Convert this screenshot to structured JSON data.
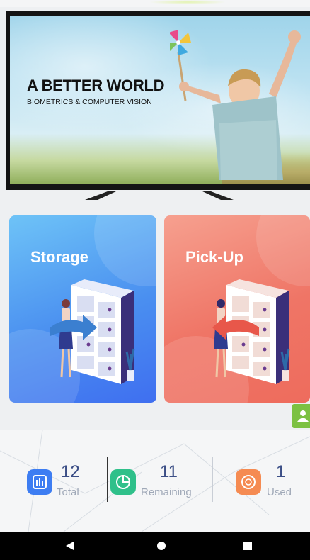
{
  "banner": {
    "headline": "A BETTER WORLD",
    "subline": "BIOMETRICS & COMPUTER VISION"
  },
  "cards": [
    {
      "id": "storage",
      "label": "Storage",
      "color": "#4a8ff0"
    },
    {
      "id": "pickup",
      "label": "Pick-Up",
      "color": "#ef7566"
    }
  ],
  "stats": [
    {
      "id": "total",
      "value": "12",
      "label": "Total",
      "icon": "bar-chart-icon",
      "color": "#3d7df2"
    },
    {
      "id": "remaining",
      "value": "11",
      "label": "Remaining",
      "icon": "pie-chart-icon",
      "color": "#2fc08a"
    },
    {
      "id": "used",
      "value": "1",
      "label": "Used",
      "icon": "coin-icon",
      "color": "#f58b52"
    }
  ],
  "side_button": {
    "icon": "contact-icon",
    "color": "#7cc142"
  },
  "navbar": {
    "back": "back-icon",
    "home": "home-icon",
    "recents": "recents-icon"
  }
}
